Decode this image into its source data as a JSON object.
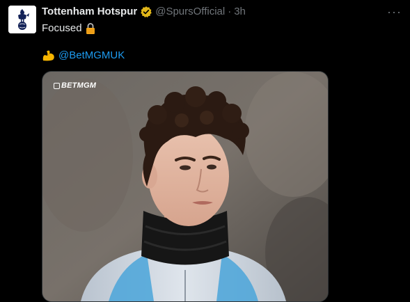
{
  "tweet": {
    "author_name": "Tottenham Hotspur",
    "author_handle": "@SpursOfficial",
    "separator": "·",
    "timestamp": "3h",
    "more_label": "···",
    "text": "Focused",
    "mention": "@BetMGMUK",
    "media": {
      "watermark": "BETMGM"
    }
  },
  "icons": {
    "verified": "verified-badge-icon",
    "lock": "lock-icon",
    "flex": "flexed-biceps-icon",
    "more": "more-icon"
  },
  "colors": {
    "background": "#000000",
    "text": "#e7e9ea",
    "muted": "#71767b",
    "link": "#1d9bf0",
    "verified": "#e2b719"
  }
}
